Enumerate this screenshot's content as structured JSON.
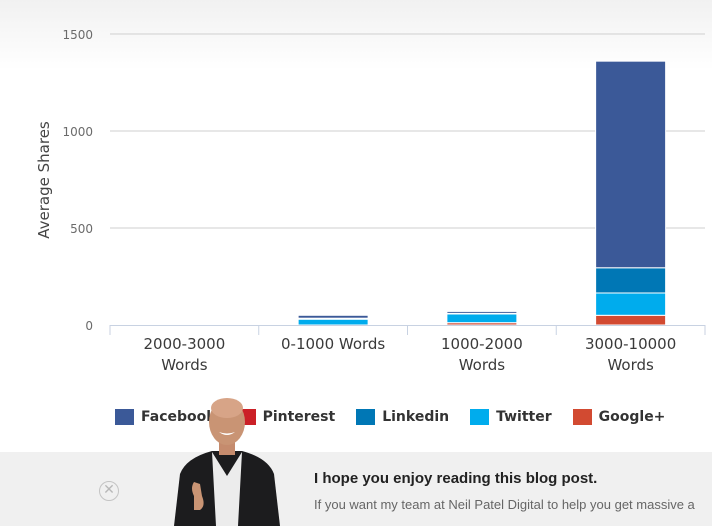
{
  "chart_data": {
    "type": "bar",
    "stacked": true,
    "title": "",
    "xlabel": "",
    "ylabel": "Average Shares",
    "ylim": [
      0,
      1500
    ],
    "yticks": [
      0,
      500,
      1000,
      1500
    ],
    "grid": true,
    "legend_position": "bottom",
    "categories": [
      [
        "2000-3000",
        "Words"
      ],
      [
        "0-1000 Words"
      ],
      [
        "1000-2000",
        "Words"
      ],
      [
        "3000-10000",
        "Words"
      ]
    ],
    "series": [
      {
        "name": "Google+",
        "color": "#d24a31",
        "values": [
          0,
          0,
          12,
          50
        ]
      },
      {
        "name": "Twitter",
        "color": "#00aced",
        "values": [
          0,
          30,
          45,
          115
        ]
      },
      {
        "name": "Linkedin",
        "color": "#0077b5",
        "values": [
          0,
          5,
          3,
          130
        ]
      },
      {
        "name": "Pinterest",
        "color": "#cb2027",
        "values": [
          0,
          0,
          0,
          0
        ]
      },
      {
        "name": "Facebook",
        "color": "#3b5998",
        "values": [
          0,
          15,
          10,
          1065
        ]
      }
    ]
  },
  "legend": [
    {
      "name": "Facebook",
      "color": "#3b5998"
    },
    {
      "name": "Pinterest",
      "color": "#cb2027"
    },
    {
      "name": "Linkedin",
      "color": "#0077b5"
    },
    {
      "name": "Twitter",
      "color": "#00aced"
    },
    {
      "name": "Google+",
      "color": "#d24a31"
    }
  ],
  "banner": {
    "close_icon": "✕",
    "title": "I hope you enjoy reading this blog post.",
    "text": "If you want my team at Neil Patel Digital to help you get massive a"
  }
}
